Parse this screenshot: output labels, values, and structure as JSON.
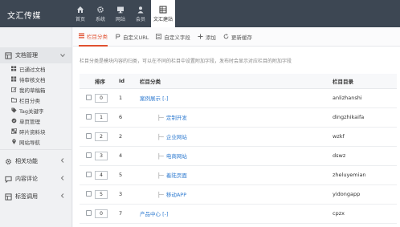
{
  "app": {
    "title": "文汇传媒"
  },
  "topnav": [
    {
      "label": "首页",
      "icon": "home-icon"
    },
    {
      "label": "系统",
      "icon": "gear-icon"
    },
    {
      "label": "网站",
      "icon": "monitor-icon"
    },
    {
      "label": "会员",
      "icon": "user-icon"
    },
    {
      "label": "文汇建站",
      "icon": "grid-icon",
      "active": true
    }
  ],
  "sidebar": {
    "group_open": {
      "label": "文档管理",
      "icon": "document-icon"
    },
    "items": [
      {
        "label": "已通过文档",
        "icon": "list-icon"
      },
      {
        "label": "待审核文档",
        "icon": "list-icon"
      },
      {
        "label": "我的草稿箱",
        "icon": "edit-icon"
      },
      {
        "label": "栏目分类",
        "icon": "folder-icon"
      },
      {
        "label": "Tag关键字",
        "icon": "tag-icon"
      },
      {
        "label": "单页管理",
        "icon": "page-icon"
      },
      {
        "label": "碎片资料块",
        "icon": "puzzle-icon"
      },
      {
        "label": "网站导航",
        "icon": "pin-icon"
      }
    ],
    "groups": [
      {
        "label": "相关功能",
        "icon": "gear-icon"
      },
      {
        "label": "内容评论",
        "icon": "comment-icon"
      },
      {
        "label": "标签调用",
        "icon": "grid-icon"
      }
    ]
  },
  "tabs": [
    {
      "label": "栏目分类",
      "icon": "list-icon",
      "active": true
    },
    {
      "label": "自定义URL",
      "icon": "link-icon"
    },
    {
      "label": "自定义字段",
      "icon": "field-icon"
    },
    {
      "label": "添加",
      "icon": "plus-icon"
    },
    {
      "label": "更新缓存",
      "icon": "refresh-icon"
    }
  ],
  "hint": "栏目分类是模块内容的归类，可以在不同的栏目中设置附加字段，发布时会显示对应栏目的附加字段",
  "table": {
    "headers": {
      "sort": "排序",
      "id": "Id",
      "name": "栏目分类",
      "dir": "栏目目录"
    },
    "rows": [
      {
        "sort": "0",
        "id": "1",
        "name": "案例展示 [-]",
        "dir": "anlizhanshi",
        "child": false
      },
      {
        "sort": "1",
        "id": "6",
        "name": "定制开发",
        "dir": "dingzhikaifa",
        "child": true
      },
      {
        "sort": "2",
        "id": "2",
        "name": "企业网站",
        "dir": "wzkf",
        "child": true
      },
      {
        "sort": "3",
        "id": "4",
        "name": "电商网站",
        "dir": "dswz",
        "child": true
      },
      {
        "sort": "4",
        "id": "5",
        "name": "着陆页面",
        "dir": "zheluyemian",
        "child": true
      },
      {
        "sort": "5",
        "id": "3",
        "name": "移动APP",
        "dir": "yidongapp",
        "child": true
      },
      {
        "sort": "0",
        "id": "7",
        "name": "产品中心 [-]",
        "dir": "cpzx",
        "child": false
      }
    ]
  }
}
